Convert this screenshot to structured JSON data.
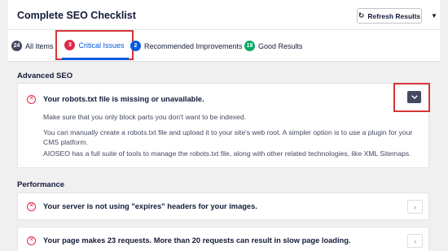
{
  "header": {
    "title": "Complete SEO Checklist",
    "refresh_label": "Refresh Results"
  },
  "tabs": [
    {
      "count": "24",
      "label": "All Items"
    },
    {
      "count": "3",
      "label": "Critical Issues"
    },
    {
      "count": "2",
      "label": "Recommended Improvements"
    },
    {
      "count": "19",
      "label": "Good Results"
    }
  ],
  "sections": {
    "advanced": {
      "title": "Advanced SEO",
      "issue": {
        "title": "Your robots.txt file is missing or unavailable.",
        "paragraphs": [
          "Make sure that you only block parts you don't want to be indexed.",
          "You can manually create a robots.txt file and upload it to your site's web root. A simpler option is to use a plugin for your CMS platform.",
          "AIOSEO has a full suite of tools to manage the robots.txt file, along with other related technologies, like XML Sitemaps."
        ]
      }
    },
    "performance": {
      "title": "Performance",
      "issues": [
        {
          "title": "Your server is not using \"expires\" headers for your images."
        },
        {
          "title": "Your page makes 23 requests. More than 20 requests can result in slow page loading."
        }
      ]
    }
  },
  "colors": {
    "critical": "#df2a4a",
    "accent": "#005ae0",
    "good": "#00aa63",
    "highlight": "#d63638"
  }
}
